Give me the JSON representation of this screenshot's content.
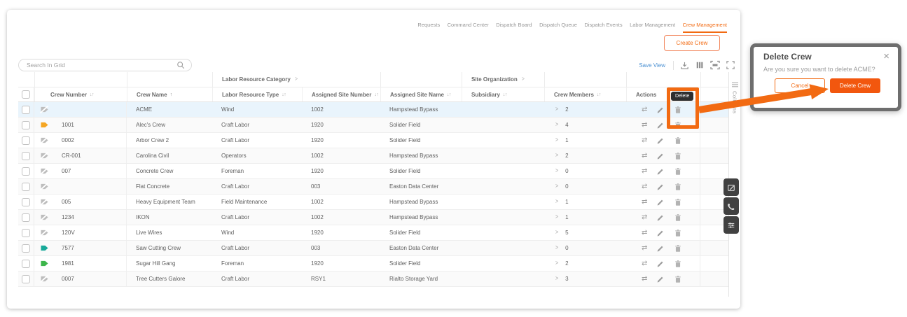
{
  "tabs": {
    "items": [
      "Requests",
      "Command Center",
      "Dispatch Board",
      "Dispatch Queue",
      "Dispatch Events",
      "Labor Management",
      "Crew Management"
    ],
    "active": "Crew Management"
  },
  "create_crew_label": "Create Crew",
  "toolbar": {
    "search_placeholder": "Search In Grid",
    "save_view_label": "Save View"
  },
  "grid": {
    "group_headers": [
      {
        "label": "Labor Resource Category"
      },
      {
        "label": "Site Organization"
      }
    ],
    "columns": [
      {
        "label": "Crew Number",
        "sort": "both"
      },
      {
        "label": "Crew Name",
        "sort": "asc"
      },
      {
        "label": "Labor Resource Type",
        "sort": "both"
      },
      {
        "label": "Assigned Site Number",
        "sort": "both"
      },
      {
        "label": "Assigned Site Name",
        "sort": "both"
      },
      {
        "label": "Subsidiary",
        "sort": "both"
      },
      {
        "label": "Crew Members",
        "sort": "both"
      },
      {
        "label": "Actions",
        "sort": "none"
      }
    ],
    "side_tab_label": "Columns",
    "rows": [
      {
        "crew_number": "",
        "crew_name": "ACME",
        "labor_resource_type": "Wind",
        "assigned_site_number": "1002",
        "assigned_site_name": "Hampstead Bypass",
        "subsidiary": "",
        "crew_members": "2",
        "tag": "grey",
        "selected": true
      },
      {
        "crew_number": "1001",
        "crew_name": "Alec's Crew",
        "labor_resource_type": "Craft Labor",
        "assigned_site_number": "1920",
        "assigned_site_name": "Solider Field",
        "subsidiary": "",
        "crew_members": "4",
        "tag": "orange",
        "selected": false
      },
      {
        "crew_number": "0002",
        "crew_name": "Arbor Crew 2",
        "labor_resource_type": "Craft Labor",
        "assigned_site_number": "1920",
        "assigned_site_name": "Solider Field",
        "subsidiary": "",
        "crew_members": "1",
        "tag": "grey",
        "selected": false
      },
      {
        "crew_number": "CR-001",
        "crew_name": "Carolina Civil",
        "labor_resource_type": "Operators",
        "assigned_site_number": "1002",
        "assigned_site_name": "Hampstead Bypass",
        "subsidiary": "",
        "crew_members": "2",
        "tag": "grey",
        "selected": false
      },
      {
        "crew_number": "007",
        "crew_name": "Concrete Crew",
        "labor_resource_type": "Foreman",
        "assigned_site_number": "1920",
        "assigned_site_name": "Solider Field",
        "subsidiary": "",
        "crew_members": "0",
        "tag": "grey",
        "selected": false
      },
      {
        "crew_number": "",
        "crew_name": "Flat Concrete",
        "labor_resource_type": "Craft Labor",
        "assigned_site_number": "003",
        "assigned_site_name": "Easton Data Center",
        "subsidiary": "",
        "crew_members": "0",
        "tag": "grey",
        "selected": false
      },
      {
        "crew_number": "005",
        "crew_name": "Heavy Equipment Team",
        "labor_resource_type": "Field Maintenance",
        "assigned_site_number": "1002",
        "assigned_site_name": "Hampstead Bypass",
        "subsidiary": "",
        "crew_members": "1",
        "tag": "grey",
        "selected": false
      },
      {
        "crew_number": "1234",
        "crew_name": "IKON",
        "labor_resource_type": "Craft Labor",
        "assigned_site_number": "1002",
        "assigned_site_name": "Hampstead Bypass",
        "subsidiary": "",
        "crew_members": "1",
        "tag": "grey",
        "selected": false
      },
      {
        "crew_number": "120V",
        "crew_name": "Live Wires",
        "labor_resource_type": "Wind",
        "assigned_site_number": "1920",
        "assigned_site_name": "Solider Field",
        "subsidiary": "",
        "crew_members": "5",
        "tag": "grey",
        "selected": false
      },
      {
        "crew_number": "7577",
        "crew_name": "Saw Cutting Crew",
        "labor_resource_type": "Craft Labor",
        "assigned_site_number": "003",
        "assigned_site_name": "Easton Data Center",
        "subsidiary": "",
        "crew_members": "0",
        "tag": "teal",
        "selected": false
      },
      {
        "crew_number": "1981",
        "crew_name": "Sugar Hill Gang",
        "labor_resource_type": "Foreman",
        "assigned_site_number": "1920",
        "assigned_site_name": "Solider Field",
        "subsidiary": "",
        "crew_members": "2",
        "tag": "green",
        "selected": false
      },
      {
        "crew_number": "0007",
        "crew_name": "Tree Cutters Galore",
        "labor_resource_type": "Craft Labor",
        "assigned_site_number": "RSY1",
        "assigned_site_name": "Rialto Storage Yard",
        "subsidiary": "",
        "crew_members": "3",
        "tag": "grey",
        "selected": false
      }
    ]
  },
  "tooltip_label": "Delete",
  "dialog": {
    "title": "Delete Crew",
    "message": "Are you sure you want to delete ACME?",
    "cancel_label": "Cancel",
    "confirm_label": "Delete Crew"
  },
  "colors": {
    "accent": "#f26a12",
    "confirm_button": "#f2570e",
    "save_view_link": "#4a90d2",
    "selected_row": "#e9f4fc",
    "tag_orange": "#f5a623",
    "tag_teal": "#18a999",
    "tag_green": "#3cb54a"
  }
}
